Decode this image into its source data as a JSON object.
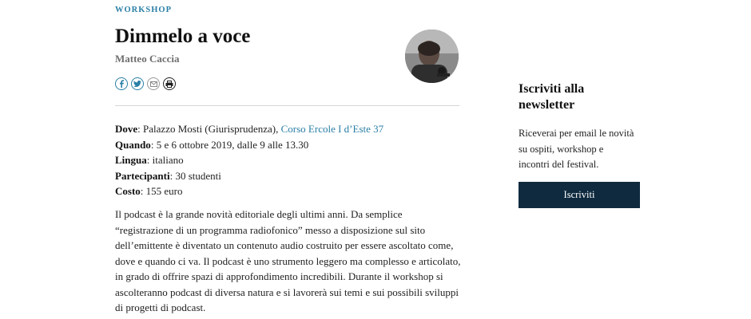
{
  "article": {
    "kicker": "WORKSHOP",
    "title": "Dimmelo a voce",
    "author": "Matteo Caccia"
  },
  "share": {
    "icons": [
      "facebook-icon",
      "twitter-icon",
      "email-icon",
      "print-icon"
    ]
  },
  "details": [
    {
      "label": "Dove",
      "value": "Palazzo Mosti (Giurisprudenza), ",
      "link": "Corso Ercole I d’Este 37"
    },
    {
      "label": "Quando",
      "value": "5 e 6 ottobre 2019, dalle 9 alle 13.30"
    },
    {
      "label": "Lingua",
      "value": "italiano"
    },
    {
      "label": "Partecipanti",
      "value": "30 studenti"
    },
    {
      "label": "Costo",
      "value": "155 euro"
    }
  ],
  "body": {
    "lines": [
      "Il podcast è la grande novità editoriale degli ultimi anni. Da semplice",
      "“registrazione di un programma radiofonico” messo a disposizione sul sito",
      "dell’emittente è diventato un contenuto audio costruito per essere ascoltato come,",
      "dove e quando ci va. Il podcast è uno strumento leggero ma complesso e articolato,",
      "in grado di offrire spazi di approfondimento incredibili. Durante il workshop si",
      "ascolteranno podcast di diversa natura e si lavorerà sui temi e sui possibili sviluppi",
      "di progetti di podcast."
    ]
  },
  "newsletter": {
    "title_lines": [
      "Iscriviti alla",
      "newsletter"
    ],
    "text_lines": [
      "Riceverai per email le novità",
      "su ospiti, workshop e",
      "incontri del festival."
    ],
    "button_label": "Iscriviti"
  },
  "colors": {
    "accent": "#2a7fa6",
    "button_bg": "#0f2a3f"
  }
}
